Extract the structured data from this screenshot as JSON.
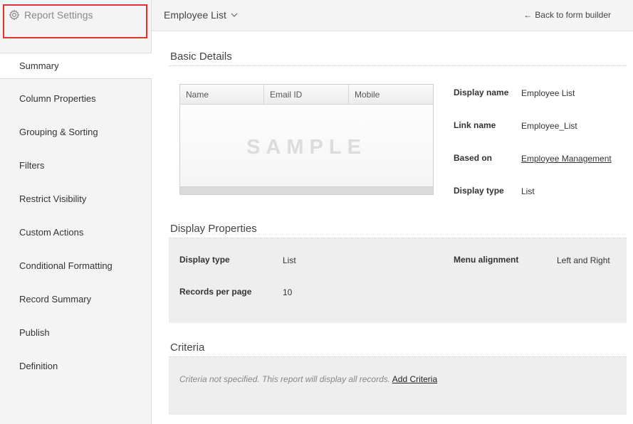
{
  "sidebar": {
    "header_label": "Report Settings",
    "items": [
      {
        "label": "Summary",
        "active": true
      },
      {
        "label": "Column Properties"
      },
      {
        "label": "Grouping & Sorting"
      },
      {
        "label": "Filters"
      },
      {
        "label": "Restrict Visibility"
      },
      {
        "label": "Custom Actions"
      },
      {
        "label": "Conditional Formatting"
      },
      {
        "label": "Record Summary"
      },
      {
        "label": "Publish"
      },
      {
        "label": "Definition"
      }
    ]
  },
  "topbar": {
    "report_name": "Employee List",
    "back_label": "Back to form builder"
  },
  "basic_details": {
    "title": "Basic Details",
    "preview": {
      "columns": [
        "Name",
        "Email ID",
        "Mobile"
      ],
      "watermark": "SAMPLE"
    },
    "fields": [
      {
        "label": "Display name",
        "value": "Employee List"
      },
      {
        "label": "Link name",
        "value": "Employee_List"
      },
      {
        "label": "Based on",
        "value": "Employee Management"
      },
      {
        "label": "Display type",
        "value": "List"
      }
    ]
  },
  "display_properties": {
    "title": "Display Properties",
    "display_type_label": "Display type",
    "display_type_value": "List",
    "records_label": "Records per page",
    "records_value": "10",
    "menu_alignment_label": "Menu alignment",
    "menu_alignment_value": "Left and Right"
  },
  "criteria": {
    "title": "Criteria",
    "message": "Criteria not specified. This report will display all records.",
    "add_label": "Add Criteria"
  }
}
